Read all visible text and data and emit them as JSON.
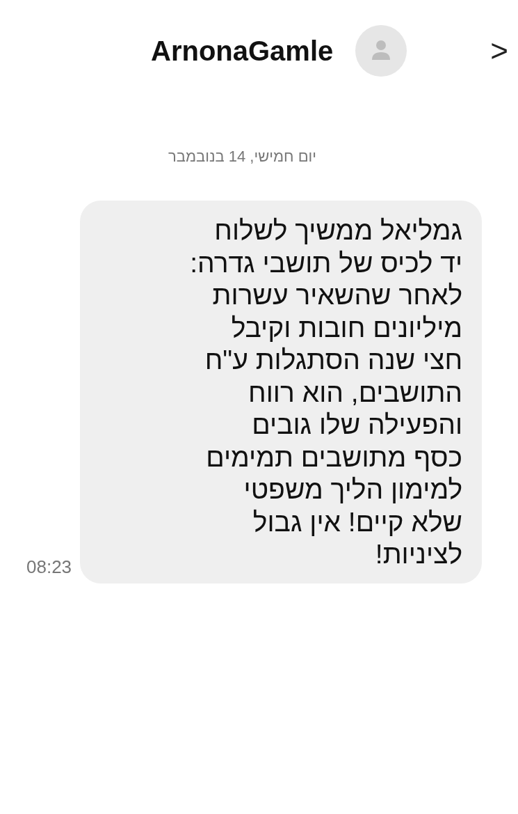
{
  "header": {
    "title": "ArnonaGamle",
    "chevron": ">"
  },
  "date": "יום חמישי, 14 בנובמבר",
  "message": {
    "text": "גמליאל ממשיך לשלוח\nיד לכיס של תושבי גדרה:\nלאחר שהשאיר עשרות\nמיליונים חובות וקיבל\nחצי שנה הסתגלות ע\"ח\nהתושבים, הוא רווח\nוהפעילה שלו גובים\nכסף מתושבים תמימים\nלמימון הליך משפטי\nשלא קיים! אין גבול\nלציניות!",
    "time": "08:23"
  }
}
